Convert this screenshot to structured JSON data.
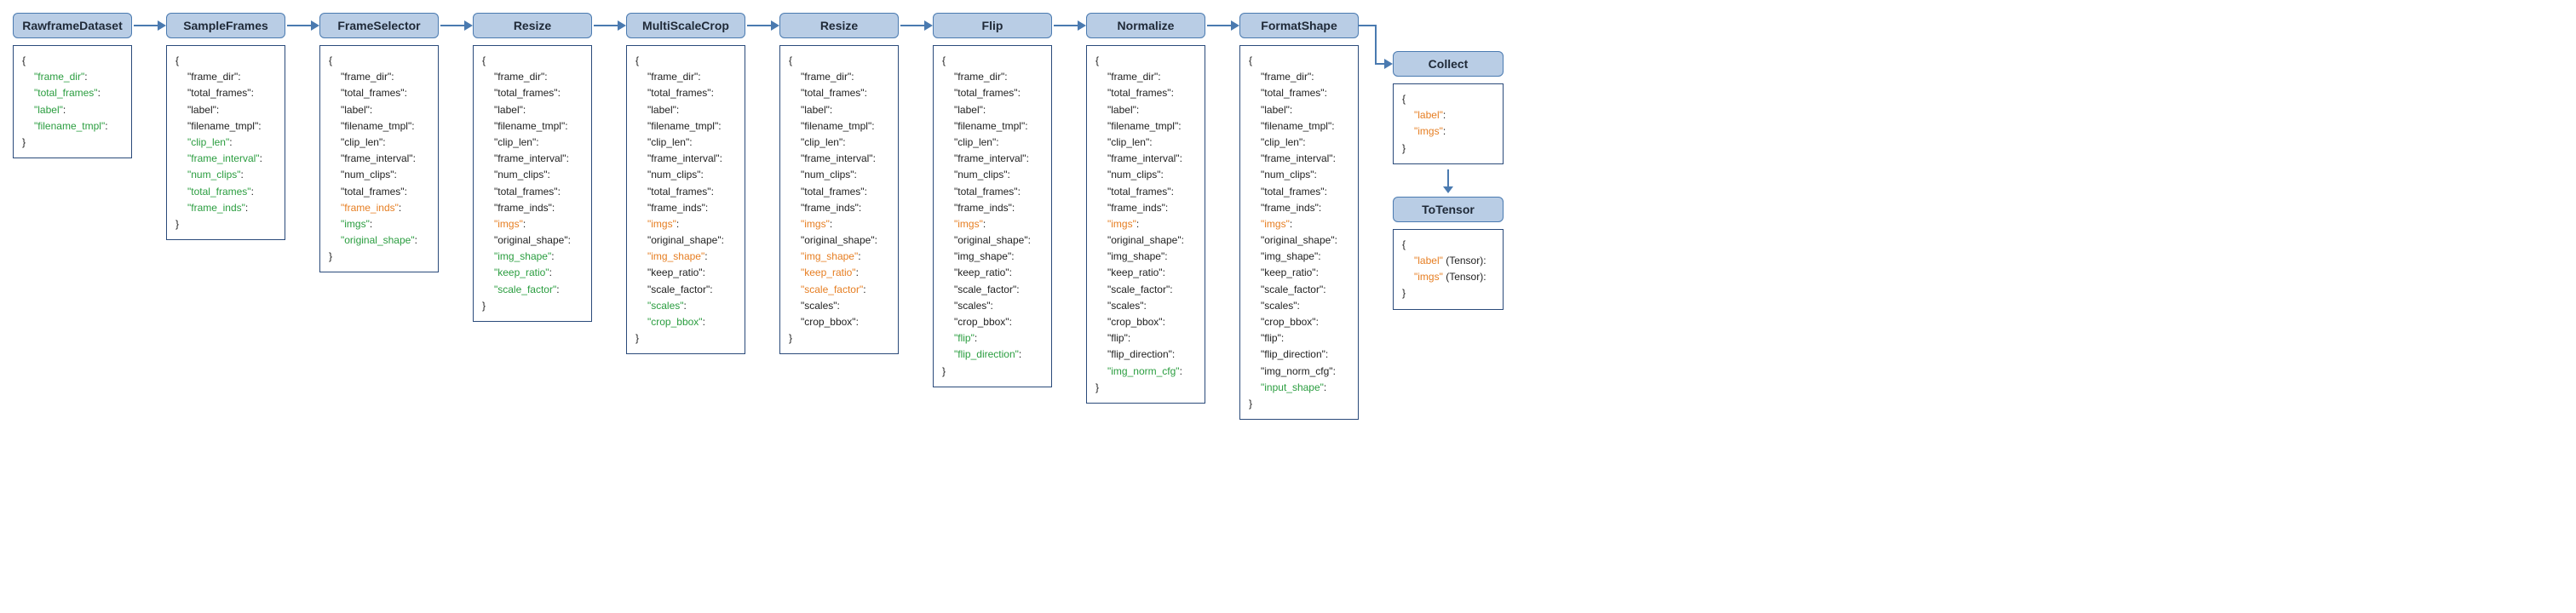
{
  "colors": {
    "header_bg": "#b9cde5",
    "header_border": "#4a7ab0",
    "body_border": "#2a4a7a",
    "key_default": "#222222",
    "key_green": "#2a9d3f",
    "key_orange": "#e67e22",
    "arrow": "#4a7ab0"
  },
  "stages": [
    {
      "id": "rawframe",
      "title": "RawframeDataset",
      "width": 140,
      "keys": [
        {
          "name": "frame_dir",
          "color": "green"
        },
        {
          "name": "total_frames",
          "color": "green"
        },
        {
          "name": "label",
          "color": "green"
        },
        {
          "name": "filename_tmpl",
          "color": "green"
        }
      ]
    },
    {
      "id": "sampleframes",
      "title": "SampleFrames",
      "width": 140,
      "keys": [
        {
          "name": "frame_dir",
          "color": "default"
        },
        {
          "name": "total_frames",
          "color": "default"
        },
        {
          "name": "label",
          "color": "default"
        },
        {
          "name": "filename_tmpl",
          "color": "default"
        },
        {
          "name": "clip_len",
          "color": "green"
        },
        {
          "name": "frame_interval",
          "color": "green"
        },
        {
          "name": "num_clips",
          "color": "green"
        },
        {
          "name": "total_frames",
          "color": "green"
        },
        {
          "name": "frame_inds",
          "color": "green"
        }
      ]
    },
    {
      "id": "frameselector",
      "title": "FrameSelector",
      "width": 140,
      "keys": [
        {
          "name": "frame_dir",
          "color": "default"
        },
        {
          "name": "total_frames",
          "color": "default"
        },
        {
          "name": "label",
          "color": "default"
        },
        {
          "name": "filename_tmpl",
          "color": "default"
        },
        {
          "name": "clip_len",
          "color": "default"
        },
        {
          "name": "frame_interval",
          "color": "default"
        },
        {
          "name": "num_clips",
          "color": "default"
        },
        {
          "name": "total_frames",
          "color": "default"
        },
        {
          "name": "frame_inds",
          "color": "orange"
        },
        {
          "name": "imgs",
          "color": "green"
        },
        {
          "name": "original_shape",
          "color": "green"
        }
      ]
    },
    {
      "id": "resize1",
      "title": "Resize",
      "width": 140,
      "keys": [
        {
          "name": "frame_dir",
          "color": "default"
        },
        {
          "name": "total_frames",
          "color": "default"
        },
        {
          "name": "label",
          "color": "default"
        },
        {
          "name": "filename_tmpl",
          "color": "default"
        },
        {
          "name": "clip_len",
          "color": "default"
        },
        {
          "name": "frame_interval",
          "color": "default"
        },
        {
          "name": "num_clips",
          "color": "default"
        },
        {
          "name": "total_frames",
          "color": "default"
        },
        {
          "name": "frame_inds",
          "color": "default"
        },
        {
          "name": "imgs",
          "color": "orange"
        },
        {
          "name": "original_shape",
          "color": "default"
        },
        {
          "name": "img_shape",
          "color": "green"
        },
        {
          "name": "keep_ratio",
          "color": "green"
        },
        {
          "name": "scale_factor",
          "color": "green"
        }
      ]
    },
    {
      "id": "multiscalecrop",
      "title": "MultiScaleCrop",
      "width": 140,
      "keys": [
        {
          "name": "frame_dir",
          "color": "default"
        },
        {
          "name": "total_frames",
          "color": "default"
        },
        {
          "name": "label",
          "color": "default"
        },
        {
          "name": "filename_tmpl",
          "color": "default"
        },
        {
          "name": "clip_len",
          "color": "default"
        },
        {
          "name": "frame_interval",
          "color": "default"
        },
        {
          "name": "num_clips",
          "color": "default"
        },
        {
          "name": "total_frames",
          "color": "default"
        },
        {
          "name": "frame_inds",
          "color": "default"
        },
        {
          "name": "imgs",
          "color": "orange"
        },
        {
          "name": "original_shape",
          "color": "default"
        },
        {
          "name": "img_shape",
          "color": "orange"
        },
        {
          "name": "keep_ratio",
          "color": "default"
        },
        {
          "name": "scale_factor",
          "color": "default"
        },
        {
          "name": "scales",
          "color": "green"
        },
        {
          "name": "crop_bbox",
          "color": "green"
        }
      ]
    },
    {
      "id": "resize2",
      "title": "Resize",
      "width": 140,
      "keys": [
        {
          "name": "frame_dir",
          "color": "default"
        },
        {
          "name": "total_frames",
          "color": "default"
        },
        {
          "name": "label",
          "color": "default"
        },
        {
          "name": "filename_tmpl",
          "color": "default"
        },
        {
          "name": "clip_len",
          "color": "default"
        },
        {
          "name": "frame_interval",
          "color": "default"
        },
        {
          "name": "num_clips",
          "color": "default"
        },
        {
          "name": "total_frames",
          "color": "default"
        },
        {
          "name": "frame_inds",
          "color": "default"
        },
        {
          "name": "imgs",
          "color": "orange"
        },
        {
          "name": "original_shape",
          "color": "default"
        },
        {
          "name": "img_shape",
          "color": "orange"
        },
        {
          "name": "keep_ratio",
          "color": "orange"
        },
        {
          "name": "scale_factor",
          "color": "orange"
        },
        {
          "name": "scales",
          "color": "default"
        },
        {
          "name": "crop_bbox",
          "color": "default"
        }
      ]
    },
    {
      "id": "flip",
      "title": "Flip",
      "width": 140,
      "keys": [
        {
          "name": "frame_dir",
          "color": "default"
        },
        {
          "name": "total_frames",
          "color": "default"
        },
        {
          "name": "label",
          "color": "default"
        },
        {
          "name": "filename_tmpl",
          "color": "default"
        },
        {
          "name": "clip_len",
          "color": "default"
        },
        {
          "name": "frame_interval",
          "color": "default"
        },
        {
          "name": "num_clips",
          "color": "default"
        },
        {
          "name": "total_frames",
          "color": "default"
        },
        {
          "name": "frame_inds",
          "color": "default"
        },
        {
          "name": "imgs",
          "color": "orange"
        },
        {
          "name": "original_shape",
          "color": "default"
        },
        {
          "name": "img_shape",
          "color": "default"
        },
        {
          "name": "keep_ratio",
          "color": "default"
        },
        {
          "name": "scale_factor",
          "color": "default"
        },
        {
          "name": "scales",
          "color": "default"
        },
        {
          "name": "crop_bbox",
          "color": "default"
        },
        {
          "name": "flip",
          "color": "green"
        },
        {
          "name": "flip_direction",
          "color": "green"
        }
      ]
    },
    {
      "id": "normalize",
      "title": "Normalize",
      "width": 140,
      "keys": [
        {
          "name": "frame_dir",
          "color": "default"
        },
        {
          "name": "total_frames",
          "color": "default"
        },
        {
          "name": "label",
          "color": "default"
        },
        {
          "name": "filename_tmpl",
          "color": "default"
        },
        {
          "name": "clip_len",
          "color": "default"
        },
        {
          "name": "frame_interval",
          "color": "default"
        },
        {
          "name": "num_clips",
          "color": "default"
        },
        {
          "name": "total_frames",
          "color": "default"
        },
        {
          "name": "frame_inds",
          "color": "default"
        },
        {
          "name": "imgs",
          "color": "orange"
        },
        {
          "name": "original_shape",
          "color": "default"
        },
        {
          "name": "img_shape",
          "color": "default"
        },
        {
          "name": "keep_ratio",
          "color": "default"
        },
        {
          "name": "scale_factor",
          "color": "default"
        },
        {
          "name": "scales",
          "color": "default"
        },
        {
          "name": "crop_bbox",
          "color": "default"
        },
        {
          "name": "flip",
          "color": "default"
        },
        {
          "name": "flip_direction",
          "color": "default"
        },
        {
          "name": "img_norm_cfg",
          "color": "green"
        }
      ]
    },
    {
      "id": "formatshape",
      "title": "FormatShape",
      "width": 140,
      "keys": [
        {
          "name": "frame_dir",
          "color": "default"
        },
        {
          "name": "total_frames",
          "color": "default"
        },
        {
          "name": "label",
          "color": "default"
        },
        {
          "name": "filename_tmpl",
          "color": "default"
        },
        {
          "name": "clip_len",
          "color": "default"
        },
        {
          "name": "frame_interval",
          "color": "default"
        },
        {
          "name": "num_clips",
          "color": "default"
        },
        {
          "name": "total_frames",
          "color": "default"
        },
        {
          "name": "frame_inds",
          "color": "default"
        },
        {
          "name": "imgs",
          "color": "orange"
        },
        {
          "name": "original_shape",
          "color": "default"
        },
        {
          "name": "img_shape",
          "color": "default"
        },
        {
          "name": "keep_ratio",
          "color": "default"
        },
        {
          "name": "scale_factor",
          "color": "default"
        },
        {
          "name": "scales",
          "color": "default"
        },
        {
          "name": "crop_bbox",
          "color": "default"
        },
        {
          "name": "flip",
          "color": "default"
        },
        {
          "name": "flip_direction",
          "color": "default"
        },
        {
          "name": "img_norm_cfg",
          "color": "default"
        },
        {
          "name": "input_shape",
          "color": "green"
        }
      ]
    }
  ],
  "right_stages": [
    {
      "id": "collect",
      "title": "Collect",
      "width": 130,
      "keys": [
        {
          "name": "label",
          "color": "orange",
          "suffix": ""
        },
        {
          "name": "imgs",
          "color": "orange",
          "suffix": ""
        }
      ]
    },
    {
      "id": "totensor",
      "title": "ToTensor",
      "width": 130,
      "keys": [
        {
          "name": "label",
          "color": "orange",
          "suffix": " (Tensor)"
        },
        {
          "name": "imgs",
          "color": "orange",
          "suffix": " (Tensor)"
        }
      ]
    }
  ]
}
